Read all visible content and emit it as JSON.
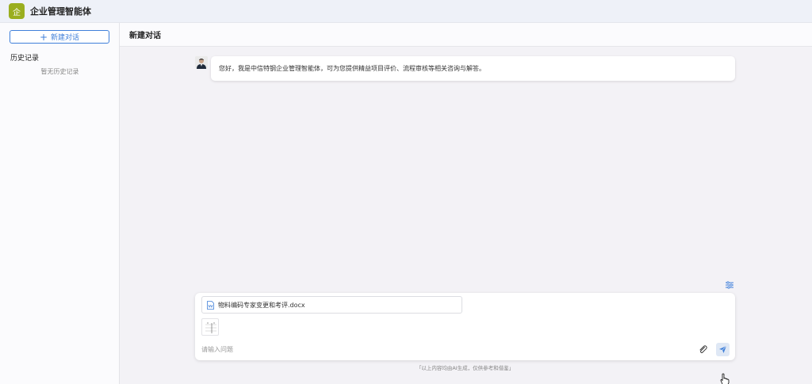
{
  "app": {
    "logo_char": "企",
    "title": "企业管理智能体",
    "brand_color": "#9aae1f",
    "accent_color": "#3f7fd9"
  },
  "sidebar": {
    "new_chat_label": "新建对话",
    "history_title": "历史记录",
    "history_empty": "暂无历史记录"
  },
  "main": {
    "title": "新建对话"
  },
  "chat": {
    "messages": [
      {
        "role": "assistant",
        "avatar": "user-avatar",
        "text": "您好，我是中信特钢企业管理智能体，可为您提供精益项目评价、流程审核等相关咨询与解答。"
      }
    ]
  },
  "composer": {
    "attachment_name": "物料编码专家变更和考评.docx",
    "placeholder": "请输入问题",
    "disclaimer": "「以上内容均由AI生成，仅供参考和借鉴」"
  },
  "icons": {
    "settings": "sliders-icon",
    "attachment": "paperclip-icon",
    "send": "send-icon",
    "document": "doc-icon"
  }
}
